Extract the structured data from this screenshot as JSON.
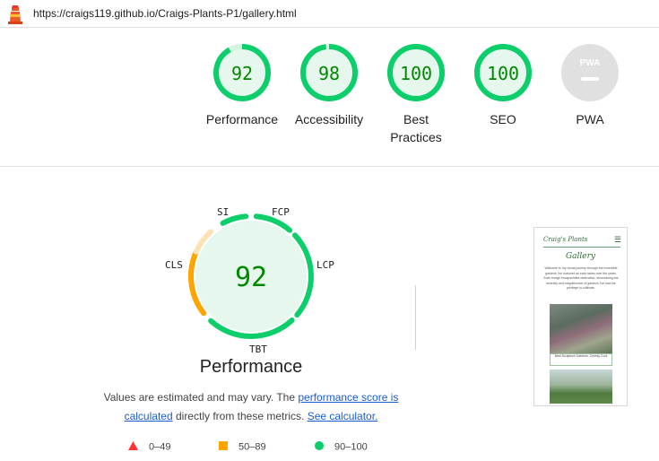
{
  "url": "https://craigs119.github.io/Craigs-Plants-P1/gallery.html",
  "colors": {
    "pass": "#0cce6b",
    "pass_text": "#008800",
    "pass_bg": "#e6f7ee",
    "average": "#ffa400",
    "fail": "#ff3333",
    "na": "#e0e0e0"
  },
  "gauges": [
    {
      "score": "92",
      "score_value": 92,
      "label_lines": [
        "Performance"
      ]
    },
    {
      "score": "98",
      "score_value": 98,
      "label_lines": [
        "Accessibility"
      ]
    },
    {
      "score": "100",
      "score_value": 100,
      "label_lines": [
        "Best",
        "Practices"
      ]
    },
    {
      "score": "100",
      "score_value": 100,
      "label_lines": [
        "SEO"
      ]
    },
    {
      "score": "",
      "badge": "PWA",
      "label_lines": [
        "PWA"
      ]
    }
  ],
  "performance": {
    "score": "92",
    "title": "Performance",
    "metrics": [
      "SI",
      "FCP",
      "LCP",
      "TBT",
      "CLS"
    ],
    "description_prefix": "Values are estimated and may vary. The ",
    "link_score": "performance score is calculated",
    "description_mid": " directly from these metrics. ",
    "link_calc": "See calculator."
  },
  "legend": [
    {
      "range": "0–49",
      "icon": "triangle-icon"
    },
    {
      "range": "50–89",
      "icon": "square-icon"
    },
    {
      "range": "90–100",
      "icon": "circle-icon"
    }
  ],
  "screenshot": {
    "brand": "Craig's Plants",
    "heading": "Gallery",
    "intro": "Welcome to my visual journey through the incredible gardens I've nurtured as each takes over the years. Each image encapsulates dedication, showcasing the diversity and magnificence of gardens I've had the privilege to cultivate.",
    "caption": "Best Sculpture Gardens, Ceredy Cork"
  }
}
